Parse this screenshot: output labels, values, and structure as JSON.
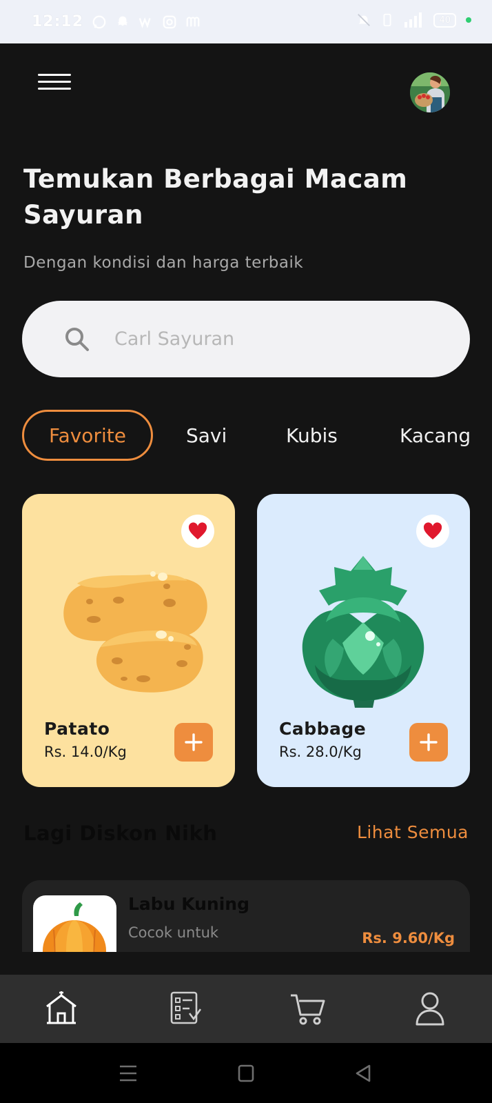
{
  "status_bar": {
    "time": "12:12",
    "battery": "40",
    "icons": [
      "whatsapp-icon",
      "snapchat-icon",
      "w-icon",
      "instagram-icon",
      "m-icon",
      "mute-icon",
      "vibrate-icon",
      "signal-icon",
      "battery-icon"
    ]
  },
  "header": {
    "menu_icon": "hamburger-icon",
    "avatar_icon": "farmer-avatar"
  },
  "hero": {
    "title": "Temukan Berbagai Macam Sayuran",
    "subtitle": "Dengan kondisi dan harga terbaik"
  },
  "search": {
    "placeholder": "Carl Sayuran",
    "icon": "search-icon"
  },
  "categories": [
    {
      "label": "Favorite",
      "active": true
    },
    {
      "label": "Savi",
      "active": false
    },
    {
      "label": "Kubis",
      "active": false
    },
    {
      "label": "Kacang",
      "active": false
    }
  ],
  "products": [
    {
      "name": "Patato",
      "price": "Rs. 14.0/Kg",
      "bg": "#fde19f",
      "favorited": true
    },
    {
      "name": "Cabbage",
      "price": "Rs. 28.0/Kg",
      "bg": "#dbebfd",
      "favorited": true
    }
  ],
  "discount_section": {
    "title": "Lagi Diskon Nikh",
    "see_all": "Lihat Semua"
  },
  "promo_item": {
    "name": "Labu Kuning",
    "desc": "Cocok untuk",
    "price": "Rs. 9.60/Kg"
  },
  "bottom_nav": {
    "items": [
      "home-icon",
      "orders-icon",
      "cart-icon",
      "profile-icon"
    ],
    "active": "home-icon"
  },
  "system_nav": [
    "recents-button",
    "home-button",
    "back-button"
  ],
  "colors": {
    "accent": "#ee8d3e",
    "background": "#141414",
    "heart": "#e0182d"
  }
}
